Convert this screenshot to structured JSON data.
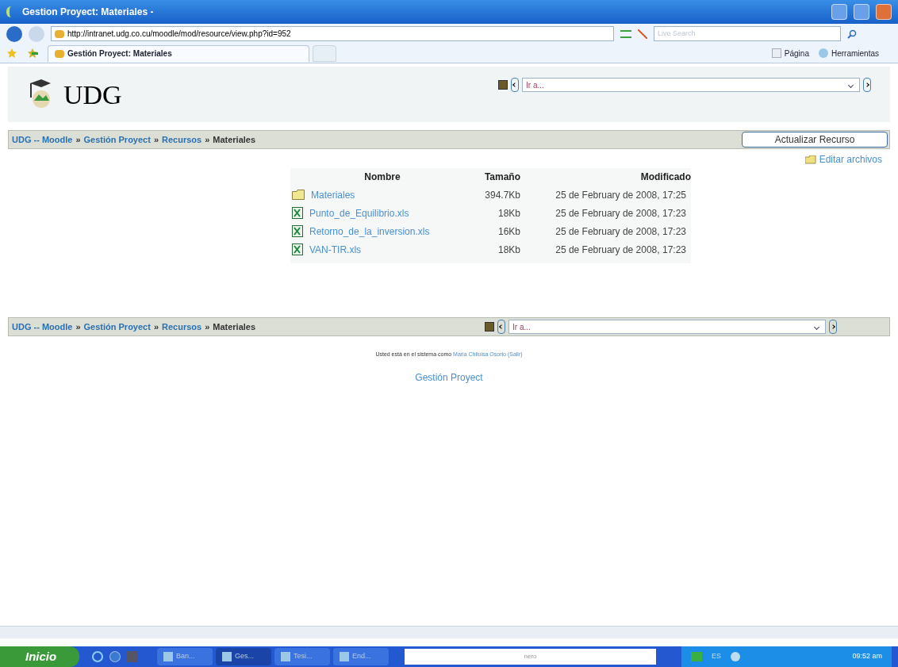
{
  "window": {
    "title": "Gestion Proyect: Materiales -"
  },
  "address_bar": {
    "url": "http://intranet.udg.co.cu/moodle/mod/resource/view.php?id=952",
    "search_placeholder": "Live Search"
  },
  "tabs": [
    {
      "label": "Gestión Proyect: Materiales",
      "selected": true
    }
  ],
  "command_bar": [
    {
      "label": "Página"
    },
    {
      "label": "Herramientas"
    }
  ],
  "site": {
    "logo": "UDG",
    "jump_menu": "Ir a..."
  },
  "breadcrumb": [
    {
      "kind": "link",
      "label": "UDG -- Moodle"
    },
    {
      "kind": "separator",
      "label": "»"
    },
    {
      "kind": "link",
      "label": "Gestión Proyect"
    },
    {
      "kind": "separator",
      "label": "»"
    },
    {
      "kind": "link",
      "label": "Recursos"
    },
    {
      "kind": "separator",
      "label": "»"
    },
    {
      "kind": "current",
      "label": "Materiales"
    }
  ],
  "update_button": "Actualizar Recurso",
  "edit_files": "Editar archivos",
  "table": {
    "columns": [
      "Nombre",
      "Tamaño",
      "Modificado"
    ],
    "rows": [
      {
        "kind": "folder",
        "name": "Materiales",
        "size": "394.7Kb",
        "modified": "25 de February de 2008, 17:25"
      },
      {
        "kind": "spreadsheet",
        "name": "Punto_de_Equilibrio.xls",
        "size": "18Kb",
        "modified": "25 de February de 2008, 17:23"
      },
      {
        "kind": "spreadsheet",
        "name": "Retorno_de_la_inversion.xls",
        "size": "16Kb",
        "modified": "25 de February de 2008, 17:23"
      },
      {
        "kind": "spreadsheet",
        "name": "VAN-TIR.xls",
        "size": "18Kb",
        "modified": "25 de February de 2008, 17:23"
      }
    ]
  },
  "bottom_bar": {
    "breadcrumb": [
      {
        "kind": "link",
        "label": "UDG -- Moodle"
      },
      {
        "kind": "separator",
        "label": "»"
      },
      {
        "kind": "link",
        "label": "Gestión Proyect"
      },
      {
        "kind": "separator",
        "label": "»"
      },
      {
        "kind": "link",
        "label": "Recursos"
      },
      {
        "kind": "separator",
        "label": "»"
      },
      {
        "kind": "current",
        "label": "Materiales"
      }
    ],
    "jump_menu": "Ir a..."
  },
  "footer": {
    "login_text": "Usted está en el sistema como",
    "user": "Maria Chiluisa Osorio",
    "logout": "(Salir)",
    "course_link": "Gestión Proyect"
  },
  "taskbar": {
    "start": "Inicio",
    "items": [
      {
        "label": "Ban...",
        "selected": false
      },
      {
        "label": "Ges...",
        "selected": true
      },
      {
        "label": "Tesi...",
        "selected": false
      },
      {
        "label": "End...",
        "selected": false
      }
    ],
    "search_brand": "nero",
    "language": "ES",
    "clock": "09:52 am"
  }
}
